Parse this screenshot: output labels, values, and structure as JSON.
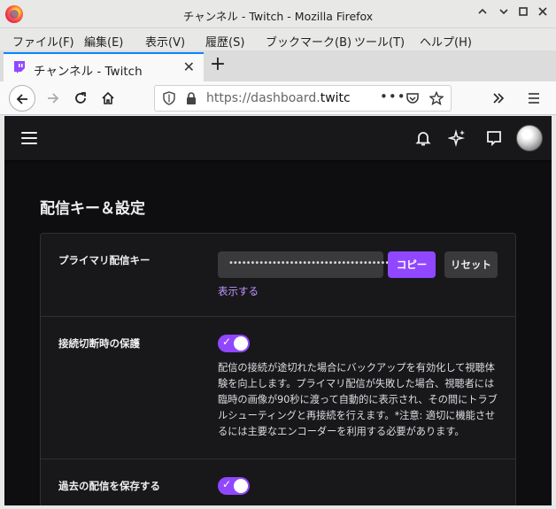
{
  "window": {
    "title": "チャンネル - Twitch - Mozilla Firefox",
    "controls": {
      "minimize": "⌃",
      "restore": "⌄",
      "maximize": "□",
      "close": "✕"
    }
  },
  "menubar": {
    "items": [
      {
        "label": "ファイル(F)"
      },
      {
        "label": "編集(E)"
      },
      {
        "label": "表示(V)"
      },
      {
        "label": "履歴(S)"
      },
      {
        "label": "ブックマーク(B)"
      },
      {
        "label": "ツール(T)"
      },
      {
        "label": "ヘルプ(H)"
      }
    ]
  },
  "tab": {
    "title": "チャンネル - Twitch",
    "close": "✕",
    "new_tab": "+"
  },
  "navbar": {
    "url_prefix": "https://dashboard.",
    "url_host": "twitch",
    "page_actions": "•••"
  },
  "page": {
    "section_title": "配信キー＆設定",
    "primary_key": {
      "label": "プライマリ配信キー",
      "masked_value": "••••••••••••••••••••••••••••••••••••••••••••••",
      "copy_label": "コピー",
      "reset_label": "リセット",
      "show_label": "表示する"
    },
    "disconnect_protection": {
      "label": "接続切断時の保護",
      "enabled": true,
      "description": "配信の接続が途切れた場合にバックアップを有効化して視聴体験を向上します。プライマリ配信が失敗した場合、視聴者には臨時の画像が90秒に渡って自動的に表示され、その間にトラブルシューティングと再接続を行えます。*注意: 適切に機能させるには主要なエンコーダーを利用する必要があります。"
    },
    "save_past_broadcasts": {
      "label": "過去の配信を保存する",
      "enabled": true
    }
  },
  "colors": {
    "accent": "#9147ff",
    "link": "#bf94ff",
    "page_bg": "#0e0e10",
    "card_bg": "#18181b"
  }
}
